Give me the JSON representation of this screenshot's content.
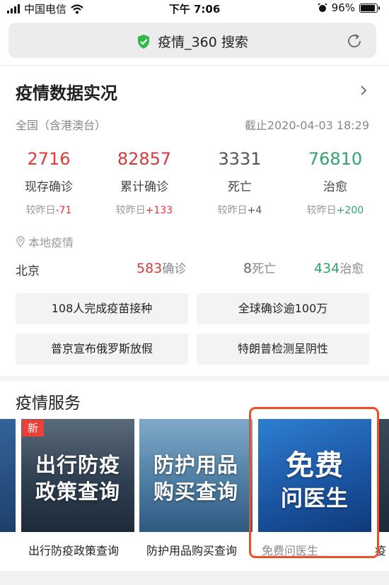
{
  "status_bar": {
    "carrier": "中国电信",
    "time": "下午 7:06",
    "battery": "96%",
    "battery_level": 0.96
  },
  "address_bar": {
    "title": "疫情_360 搜索"
  },
  "panel": {
    "title": "疫情数据实况",
    "region": "全国（含港澳台）",
    "updated": "截止2020-04-03 18:29"
  },
  "stats": [
    {
      "value": "2716",
      "label": "现存确诊",
      "delta_prefix": "较昨日",
      "delta": "-71",
      "color": "#e53935"
    },
    {
      "value": "82857",
      "label": "累计确诊",
      "delta_prefix": "较昨日",
      "delta": "+133",
      "color": "#d63b3b"
    },
    {
      "value": "3331",
      "label": "死亡",
      "delta_prefix": "较昨日",
      "delta": "+4",
      "color": "#555555"
    },
    {
      "value": "76810",
      "label": "治愈",
      "delta_prefix": "较昨日",
      "delta": "+200",
      "color": "#2ea66b"
    }
  ],
  "local": {
    "heading": "本地疫情",
    "city": "北京",
    "confirmed": "583",
    "confirmed_label": "确诊",
    "deaths": "8",
    "deaths_label": "死亡",
    "cured": "434",
    "cured_label": "治愈"
  },
  "news": [
    "108人完成疫苗接种",
    "全球确诊逾100万",
    "普京宣布俄罗斯放假",
    "特朗普检测呈阴性"
  ],
  "services": {
    "title": "疫情服务",
    "cards": [
      {
        "overlay_line1": "出行防疫",
        "overlay_line2": "政策查询",
        "badge": "新",
        "caption": "出行防疫政策查询"
      },
      {
        "overlay_line1": "防护用品",
        "overlay_line2": "购买查询",
        "caption": "防护用品购买查询"
      },
      {
        "overlay_line1": "免费",
        "overlay_line2": "问医生",
        "caption": "免费问医生"
      }
    ],
    "peek_caption": "疫"
  }
}
